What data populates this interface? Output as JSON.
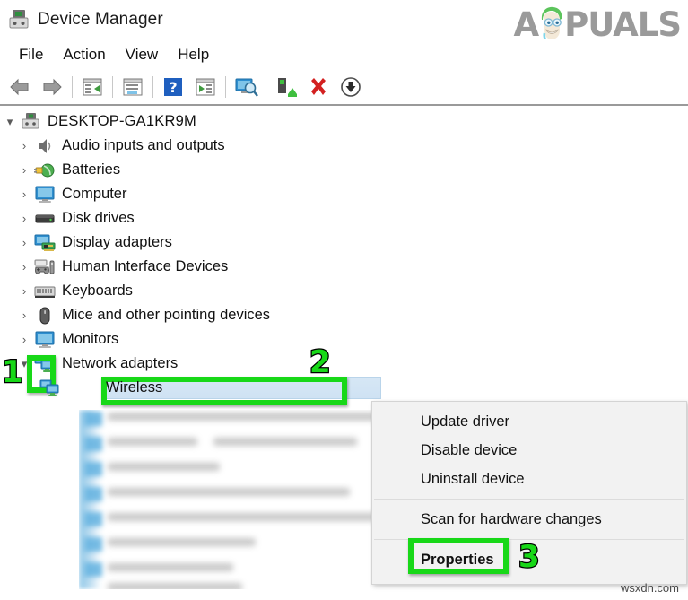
{
  "window": {
    "title": "Device Manager",
    "title_icon": "device-manager-icon"
  },
  "brand": {
    "logo_text_left": "A",
    "logo_text_right": "PUALS",
    "logo_name": "appuals-logo",
    "accent_color": "#9a9a9a"
  },
  "menubar": {
    "items": [
      {
        "label": "File"
      },
      {
        "label": "Action"
      },
      {
        "label": "View"
      },
      {
        "label": "Help"
      }
    ]
  },
  "toolbar": {
    "buttons": [
      {
        "name": "back-icon",
        "tooltip": "Back"
      },
      {
        "name": "forward-icon",
        "tooltip": "Forward"
      },
      {
        "name": "show-hide-console-tree-icon",
        "tooltip": "Show/Hide console tree"
      },
      {
        "name": "properties-icon",
        "tooltip": "Properties"
      },
      {
        "name": "help-icon",
        "tooltip": "Help"
      },
      {
        "name": "next-icon",
        "tooltip": "Next"
      },
      {
        "name": "scan-hardware-changes-icon",
        "tooltip": "Scan for hardware changes"
      },
      {
        "name": "update-driver-icon",
        "tooltip": "Update driver"
      },
      {
        "name": "disable-device-icon",
        "tooltip": "Disable device"
      },
      {
        "name": "uninstall-device-icon",
        "tooltip": "Uninstall device"
      }
    ]
  },
  "tree": {
    "root": {
      "label": "DESKTOP-GA1KR9M",
      "icon": "computer-root-icon",
      "expanded": true
    },
    "items": [
      {
        "label": "Audio inputs and outputs",
        "icon": "speaker-icon",
        "expanded": false
      },
      {
        "label": "Batteries",
        "icon": "battery-icon",
        "expanded": false
      },
      {
        "label": "Computer",
        "icon": "monitor-icon",
        "expanded": false
      },
      {
        "label": "Disk drives",
        "icon": "disk-drive-icon",
        "expanded": false
      },
      {
        "label": "Display adapters",
        "icon": "display-adapter-icon",
        "expanded": false
      },
      {
        "label": "Human Interface Devices",
        "icon": "hid-gamepad-icon",
        "expanded": false
      },
      {
        "label": "Keyboards",
        "icon": "keyboard-icon",
        "expanded": false
      },
      {
        "label": "Mice and other pointing devices",
        "icon": "mouse-icon",
        "expanded": false
      },
      {
        "label": "Monitors",
        "icon": "monitor-icon",
        "expanded": false
      },
      {
        "label": "Network adapters",
        "icon": "network-adapter-icon",
        "expanded": true
      }
    ],
    "selected_child": {
      "label": "Wireless",
      "icon": "network-adapter-icon",
      "selected": true
    }
  },
  "context_menu": {
    "items": [
      {
        "label": "Update driver",
        "bold": false,
        "separator_after": false
      },
      {
        "label": "Disable device",
        "bold": false,
        "separator_after": false
      },
      {
        "label": "Uninstall device",
        "bold": false,
        "separator_after": true
      },
      {
        "label": "Scan for hardware changes",
        "bold": false,
        "separator_after": true
      },
      {
        "label": "Properties",
        "bold": true,
        "separator_after": false
      }
    ]
  },
  "annotations": {
    "color": "#18d818",
    "markers": [
      {
        "number": "1",
        "target": "network-adapters-expand-chevron"
      },
      {
        "number": "2",
        "target": "wireless-tree-item"
      },
      {
        "number": "3",
        "target": "properties-menu-item"
      }
    ]
  },
  "watermark": {
    "text": "wsxdn.com"
  }
}
